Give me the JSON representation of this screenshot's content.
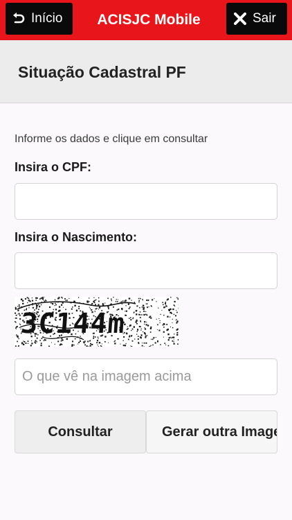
{
  "header": {
    "back_label": "Início",
    "back_icon": "undo-arrow-icon",
    "app_title": "ACISJC Mobile",
    "exit_label": "Sair",
    "exit_icon": "close-icon",
    "accent_color": "#e8161b"
  },
  "page": {
    "title": "Situação Cadastral PF"
  },
  "form": {
    "instructions": "Informe os dados e clique em consultar",
    "cpf_label": "Insira o CPF:",
    "cpf_value": "",
    "birth_label": "Insira o Nascimento:",
    "birth_value": "",
    "captcha_text": "3C144m",
    "captcha_placeholder": "O que vê na imagem acima",
    "submit_label": "Consultar",
    "regenerate_label": "Gerar outra Imagem"
  }
}
